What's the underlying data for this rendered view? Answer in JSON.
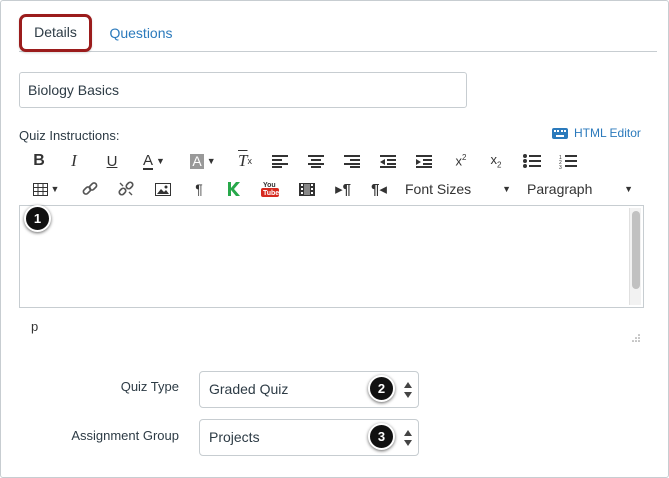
{
  "tabs": [
    {
      "label": "Details",
      "active": true
    },
    {
      "label": "Questions",
      "active": false
    }
  ],
  "quiz_title": "Biology Basics",
  "instructions": {
    "label": "Quiz Instructions:",
    "html_editor_link": "HTML Editor",
    "status_path": "p"
  },
  "toolbar": {
    "font_sizes_label": "Font Sizes",
    "paragraph_label": "Paragraph"
  },
  "fields": {
    "quiz_type": {
      "label": "Quiz Type",
      "value": "Graded Quiz"
    },
    "assignment_group": {
      "label": "Assignment Group",
      "value": "Projects"
    }
  },
  "badges": [
    "1",
    "2",
    "3"
  ],
  "colors": {
    "link": "#2b7abc",
    "highlight_border": "#9b1c1c",
    "border": "#c7cdd1",
    "text": "#2d3b45"
  }
}
